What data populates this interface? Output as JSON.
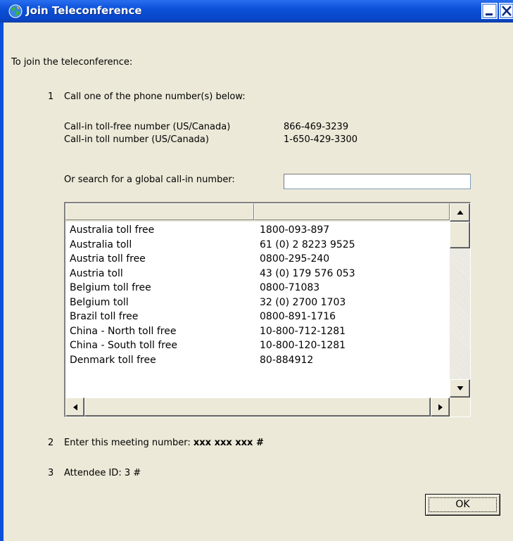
{
  "window": {
    "title": "Join Teleconference"
  },
  "intro": "To join the teleconference:",
  "step1": {
    "number": "1",
    "text": "Call one of the phone number(s) below:",
    "numbers": [
      {
        "label": "Call-in toll-free number (US/Canada)",
        "value": "866-469-3239"
      },
      {
        "label": "Call-in toll number (US/Canada)",
        "value": "1-650-429-3300"
      }
    ],
    "search_label": "Or search for a global call-in number:",
    "search_value": ""
  },
  "list": {
    "columns": [
      "",
      ""
    ],
    "rows": [
      {
        "country": "Australia toll free",
        "number": "1800-093-897"
      },
      {
        "country": "Australia toll",
        "number": "61 (0) 2 8223 9525"
      },
      {
        "country": "Austria toll free",
        "number": "0800-295-240"
      },
      {
        "country": "Austria toll",
        "number": "43 (0) 179 576 053"
      },
      {
        "country": "Belgium toll free",
        "number": "0800-71083"
      },
      {
        "country": "Belgium toll",
        "number": "32 (0) 2700 1703"
      },
      {
        "country": "Brazil toll free",
        "number": "0800-891-1716"
      },
      {
        "country": "China - North toll free",
        "number": "10-800-712-1281"
      },
      {
        "country": "China - South toll free",
        "number": "10-800-120-1281"
      },
      {
        "country": "Denmark toll free",
        "number": "80-884912"
      }
    ]
  },
  "step2": {
    "number": "2",
    "text": "Enter this meeting number:",
    "value": "xxx xxx xxx #"
  },
  "step3": {
    "number": "3",
    "text": "Attendee ID: 3 #"
  },
  "buttons": {
    "ok": "OK"
  },
  "colors": {
    "titlebar": "#0b50d8",
    "background": "#ece9d8"
  }
}
